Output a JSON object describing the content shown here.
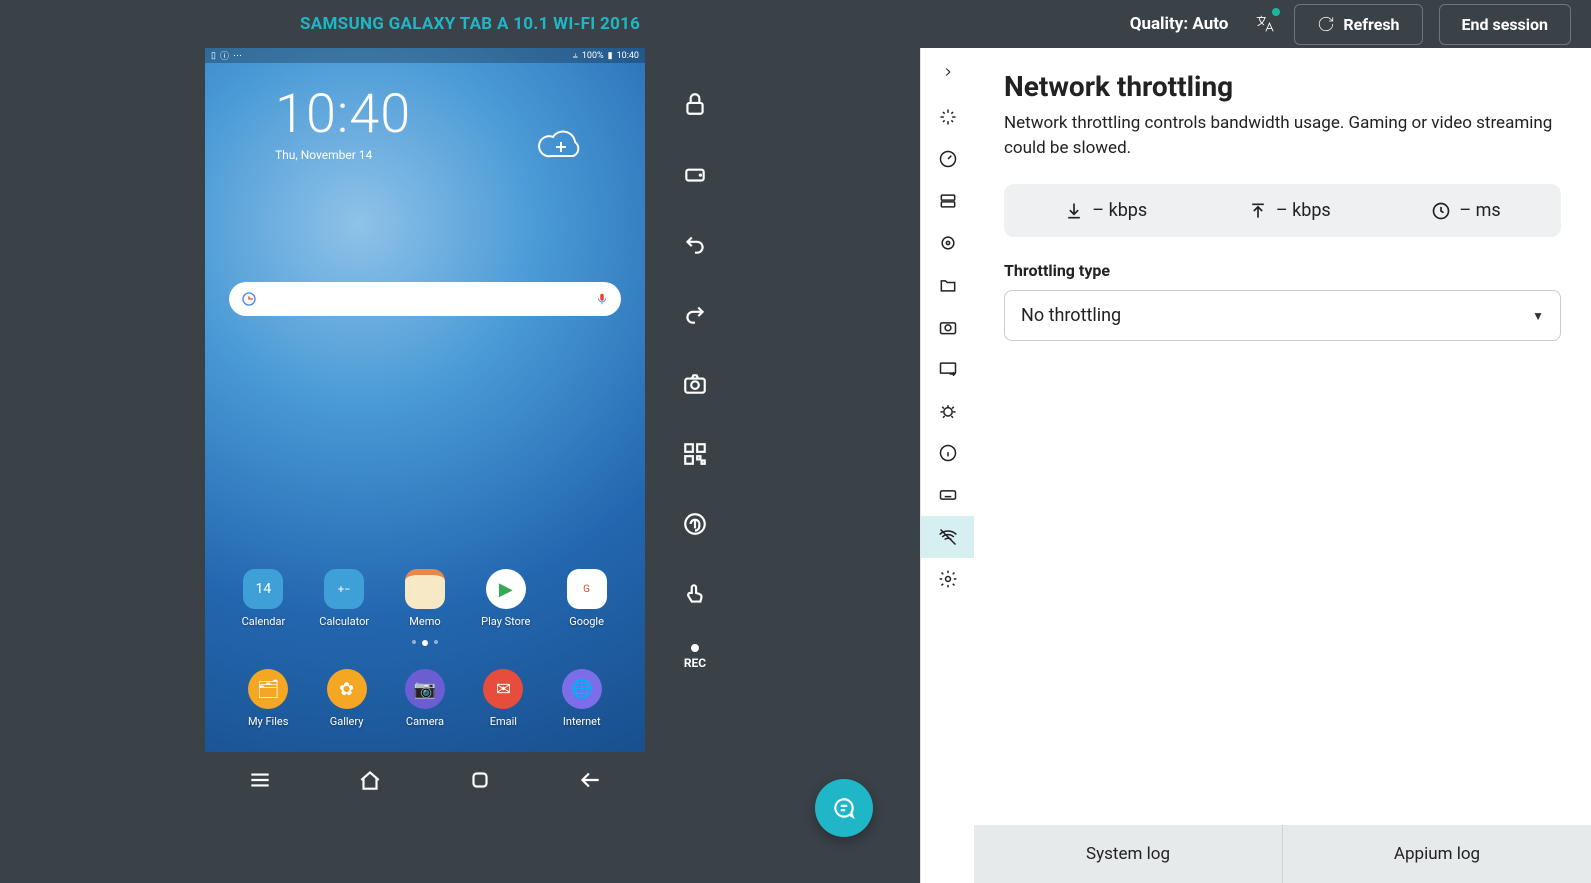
{
  "header": {
    "device_title": "SAMSUNG GALAXY TAB A 10.1 WI-FI 2016",
    "quality": "Quality: Auto",
    "refresh": "Refresh",
    "end_session": "End session"
  },
  "device": {
    "status_battery": "100%",
    "status_time": "10:40",
    "clock_time": "10:40",
    "clock_date": "Thu, November 14",
    "apps_row": [
      {
        "label": "Calendar",
        "glyph": "14"
      },
      {
        "label": "Calculator",
        "glyph": "+−"
      },
      {
        "label": "Memo",
        "glyph": ""
      },
      {
        "label": "Play Store",
        "glyph": "▶"
      },
      {
        "label": "Google",
        "glyph": "G"
      }
    ],
    "dock": [
      {
        "label": "My Files",
        "glyph": "🗂"
      },
      {
        "label": "Gallery",
        "glyph": "✿"
      },
      {
        "label": "Camera",
        "glyph": "📷"
      },
      {
        "label": "Email",
        "glyph": "✉"
      },
      {
        "label": "Internet",
        "glyph": "🌐"
      }
    ]
  },
  "dev_controls": {
    "rec": "REC"
  },
  "panel": {
    "title": "Network throttling",
    "description": "Network throttling controls bandwidth usage. Gaming or video streaming could be slowed.",
    "stat_download": "– kbps",
    "stat_upload": "– kbps",
    "stat_latency": "– ms",
    "throttling_label": "Throttling type",
    "throttling_value": "No throttling"
  },
  "footer": {
    "system_log": "System log",
    "appium_log": "Appium log"
  }
}
